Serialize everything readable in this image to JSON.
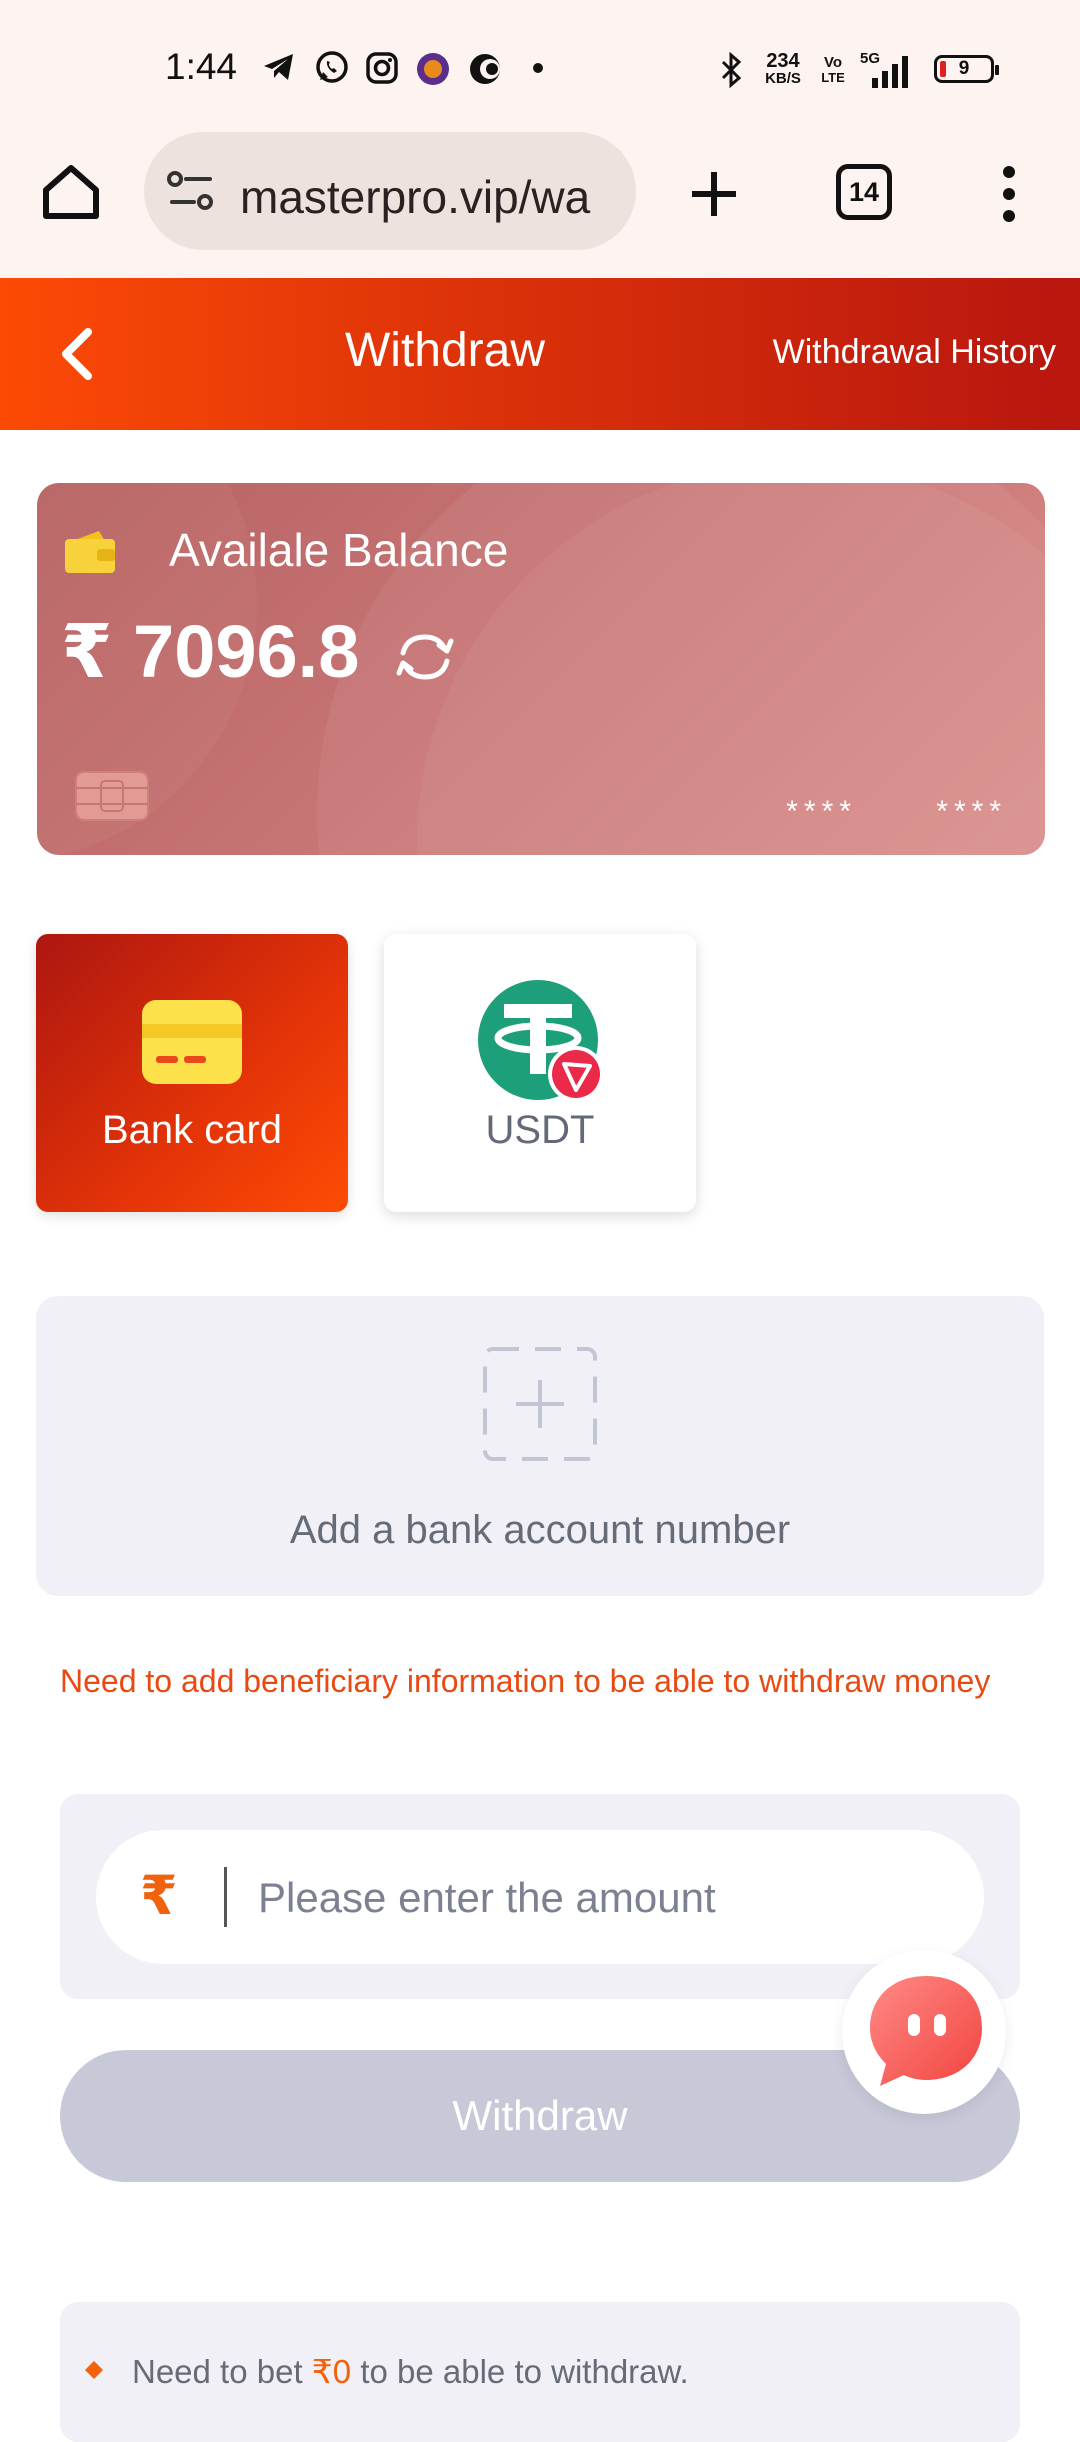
{
  "status_bar": {
    "time": "1:44",
    "net_speed": "234",
    "net_unit": "KB/S",
    "volte_top": "Vo",
    "volte_bottom": "LTE",
    "network": "5G",
    "battery": "9",
    "icons": [
      "telegram-icon",
      "whatsapp-icon",
      "instagram-icon",
      "app-icon",
      "app-icon",
      "dot-icon",
      "bluetooth-icon",
      "signal-icon",
      "battery-icon"
    ]
  },
  "browser": {
    "url": "masterpro.vip/wa",
    "tab_count": "14"
  },
  "header": {
    "title": "Withdraw",
    "history_link": "Withdrawal History"
  },
  "balance": {
    "label": "Availale Balance",
    "amount": "₹ 7096.8",
    "masked_1": "****",
    "masked_2": "****"
  },
  "methods": [
    {
      "label": "Bank card",
      "selected": true
    },
    {
      "label": "USDT",
      "selected": false
    }
  ],
  "add_bank": {
    "label": "Add a bank account number"
  },
  "warning": "Need to add beneficiary information to be able to withdraw money",
  "amount_input": {
    "currency": "₹",
    "placeholder": "Please enter the amount",
    "value": ""
  },
  "withdraw_button": "Withdraw",
  "notice": {
    "prefix": "Need to bet",
    "amount": "₹0",
    "suffix": "to be able to withdraw."
  },
  "colors": {
    "accent": "#f2610b",
    "header_start": "#fc4a05",
    "header_end": "#b8160f",
    "card": "#c77474",
    "disabled_button": "#c7c9d9"
  }
}
